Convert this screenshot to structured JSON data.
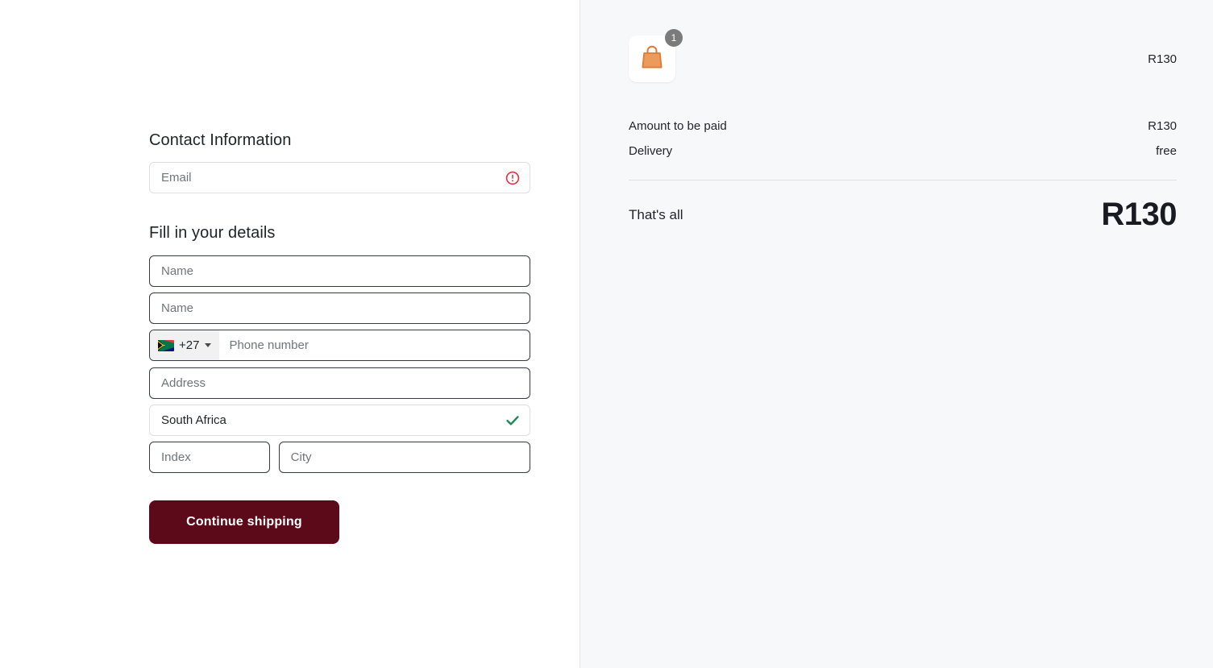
{
  "checkout": {
    "contact": {
      "heading": "Contact Information",
      "email_placeholder": "Email",
      "email_value": "",
      "email_status_icon": "error-circle-icon"
    },
    "details": {
      "heading": "Fill in your details",
      "first_name_placeholder": "Name",
      "first_name_value": "",
      "last_name_placeholder": "Name",
      "last_name_value": "",
      "phone": {
        "flag_icon": "south-africa-flag-icon",
        "dial_code": "+27",
        "placeholder": "Phone number",
        "value": ""
      },
      "address_placeholder": "Address",
      "address_value": "",
      "country_value": "South Africa",
      "country_status_icon": "check-icon",
      "index_placeholder": "Index",
      "index_value": "",
      "city_placeholder": "City",
      "city_value": ""
    },
    "submit_label": "Continue shipping"
  },
  "summary": {
    "bag_icon": "shopping-bag-icon",
    "item_count": "1",
    "bag_price": "R130",
    "rows": [
      {
        "label": "Amount to be paid",
        "value": "R130"
      },
      {
        "label": "Delivery",
        "value": "free"
      }
    ],
    "total_label": "That's all",
    "total_value": "R130"
  },
  "colors": {
    "accent": "#5c0a1a",
    "error": "#e0303f",
    "success": "#1e8a54",
    "bag": "#e8914a",
    "panel_bg": "#f7f8fa"
  }
}
